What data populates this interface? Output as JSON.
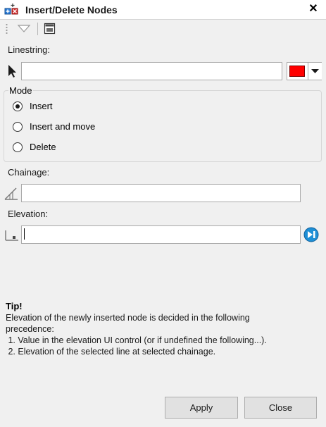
{
  "window": {
    "title": "Insert/Delete Nodes",
    "close_glyph": "✕"
  },
  "toolbar": {
    "icons": [
      "dropdown-triangle-icon",
      "window-icon"
    ]
  },
  "linestring": {
    "label": "Linestring:",
    "value": "",
    "color": "#ff0000",
    "icon": "pointer-arrow-icon"
  },
  "mode": {
    "title": "Mode",
    "selected": "Insert",
    "options": [
      {
        "label": "Insert",
        "checked": true
      },
      {
        "label": "Insert and move",
        "checked": false
      },
      {
        "label": "Delete",
        "checked": false
      }
    ]
  },
  "chainage": {
    "label": "Chainage:",
    "value": "",
    "icon": "chainage-icon"
  },
  "elevation": {
    "label": "Elevation:",
    "value": "",
    "icon": "elevation-icon",
    "action_icon": "pick-elevation-icon"
  },
  "tip": {
    "title": "Tip!",
    "lines": [
      "Elevation of the newly inserted node is decided in the following",
      "precedence:",
      " 1. Value in the elevation UI control (or if undefined the following...).",
      " 2. Elevation of the selected line at selected chainage."
    ]
  },
  "buttons": {
    "apply": "Apply",
    "close": "Close"
  }
}
